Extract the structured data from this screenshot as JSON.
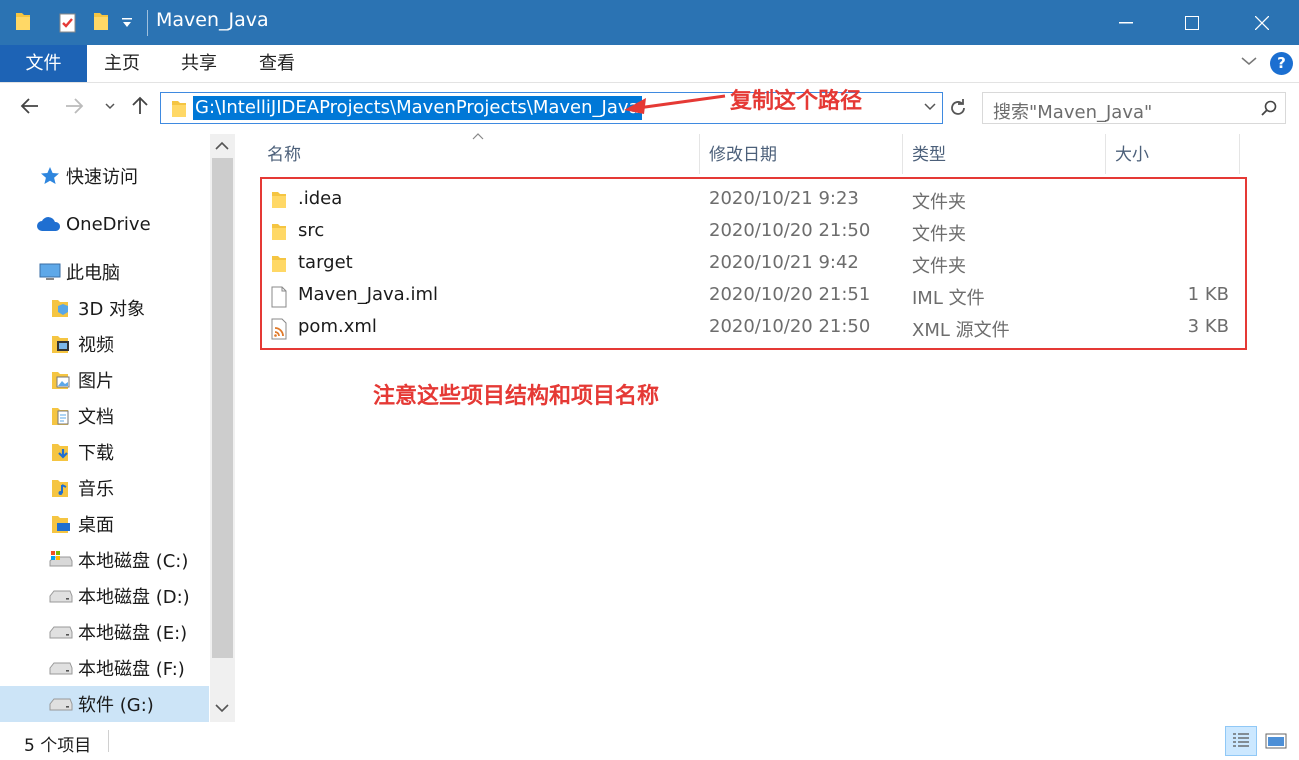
{
  "window": {
    "title": "Maven_Java",
    "controls": {
      "minimize": "minimize",
      "maximize": "maximize",
      "close": "close"
    }
  },
  "ribbon": {
    "tabs": [
      {
        "label": "文件",
        "active": true
      },
      {
        "label": "主页"
      },
      {
        "label": "共享"
      },
      {
        "label": "查看"
      }
    ],
    "help": "?"
  },
  "address": {
    "path": "G:\\IntelliJIDEAProjects\\MavenProjects\\Maven_Java",
    "search_placeholder": "搜索\"Maven_Java\""
  },
  "annotations": {
    "copy_path": "复制这个路径",
    "note": "注意这些项目结构和项目名称"
  },
  "sidebar": {
    "items": [
      {
        "label": "快速访问",
        "icon": "star-icon"
      },
      {
        "label": "OneDrive",
        "icon": "cloud-icon"
      },
      {
        "label": "此电脑",
        "icon": "computer-icon"
      },
      {
        "label": "3D 对象",
        "icon": "3d-objects-icon"
      },
      {
        "label": "视频",
        "icon": "video-icon"
      },
      {
        "label": "图片",
        "icon": "pictures-icon"
      },
      {
        "label": "文档",
        "icon": "documents-icon"
      },
      {
        "label": "下载",
        "icon": "download-icon"
      },
      {
        "label": "音乐",
        "icon": "music-icon"
      },
      {
        "label": "桌面",
        "icon": "desktop-icon"
      },
      {
        "label": "本地磁盘 (C:)",
        "icon": "drive-c-icon"
      },
      {
        "label": "本地磁盘 (D:)",
        "icon": "drive-icon"
      },
      {
        "label": "本地磁盘 (E:)",
        "icon": "drive-icon"
      },
      {
        "label": "本地磁盘 (F:)",
        "icon": "drive-icon"
      },
      {
        "label": "软件 (G:)",
        "icon": "drive-icon",
        "selected": true
      }
    ]
  },
  "columns": {
    "name": "名称",
    "date": "修改日期",
    "type": "类型",
    "size": "大小"
  },
  "files": [
    {
      "name": ".idea",
      "date": "2020/10/21 9:23",
      "type": "文件夹",
      "size": "",
      "icon": "folder-icon"
    },
    {
      "name": "src",
      "date": "2020/10/20 21:50",
      "type": "文件夹",
      "size": "",
      "icon": "folder-icon"
    },
    {
      "name": "target",
      "date": "2020/10/21 9:42",
      "type": "文件夹",
      "size": "",
      "icon": "folder-icon"
    },
    {
      "name": "Maven_Java.iml",
      "date": "2020/10/20 21:51",
      "type": "IML 文件",
      "size": "1 KB",
      "icon": "file-icon"
    },
    {
      "name": "pom.xml",
      "date": "2020/10/20 21:50",
      "type": "XML 源文件",
      "size": "3 KB",
      "icon": "xml-file-icon"
    }
  ],
  "status": {
    "item_count": "5 个项目"
  },
  "colors": {
    "titlebar": "#2b73b3",
    "accent": "#1d63b5",
    "annotation": "#e53935",
    "selection": "#0078d7"
  }
}
